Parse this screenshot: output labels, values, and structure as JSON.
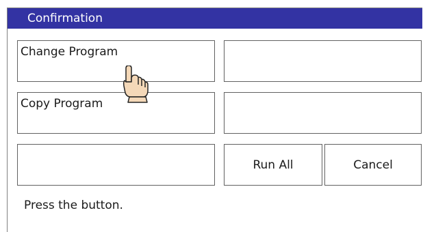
{
  "window": {
    "title": "Confirmation"
  },
  "buttons": {
    "change_program": "Change Program",
    "copy_program": "Copy Program",
    "run_all": "Run All",
    "cancel": "Cancel"
  },
  "status": {
    "message": "Press the button."
  },
  "pointer": {
    "icon": "pointing-hand-icon"
  },
  "colors": {
    "titlebar": "#3333a3",
    "hand_fill": "#f4d8b8"
  }
}
